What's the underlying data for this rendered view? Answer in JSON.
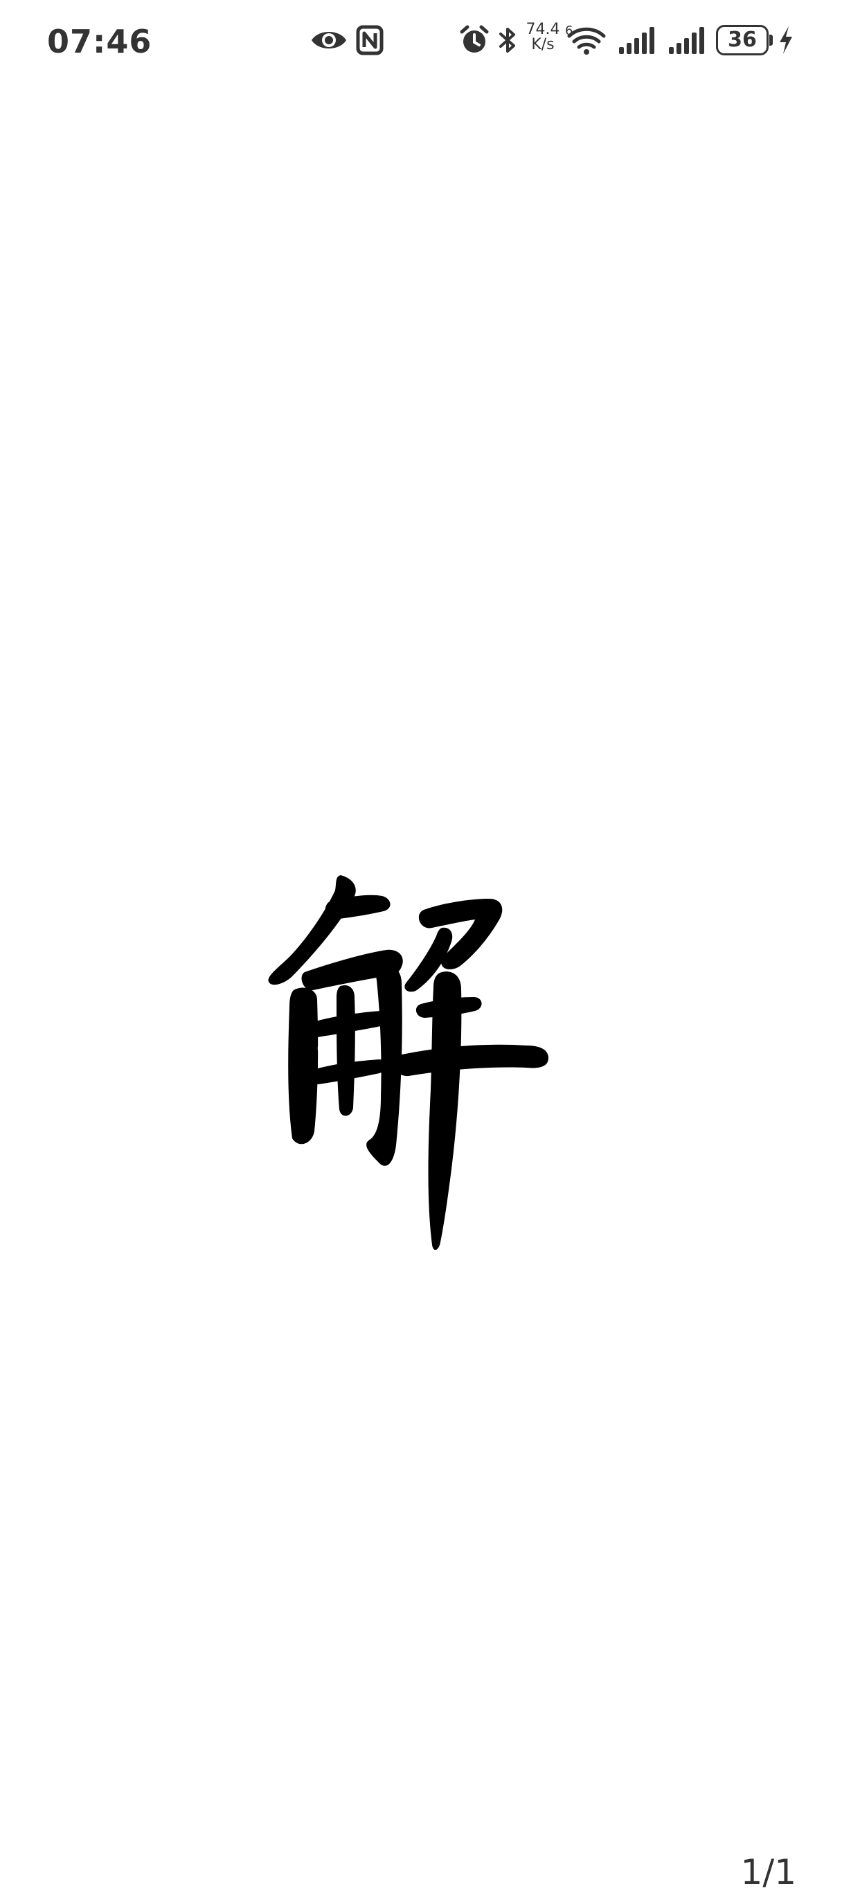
{
  "status_bar": {
    "time": "07:46",
    "net_speed_value": "74.4",
    "net_speed_unit": "K/s",
    "wifi_badge": "6",
    "battery_level": "36",
    "icons": [
      "eye-icon",
      "nfc-icon",
      "alarm-icon",
      "bluetooth-icon",
      "wifi-icon",
      "signal-icon",
      "signal-icon",
      "battery-icon",
      "charging-icon"
    ]
  },
  "viewer": {
    "image_character": "解",
    "page_counter": "1/1"
  },
  "colors": {
    "background": "#ffffff",
    "ink": "#000000",
    "status_text": "#333333"
  }
}
